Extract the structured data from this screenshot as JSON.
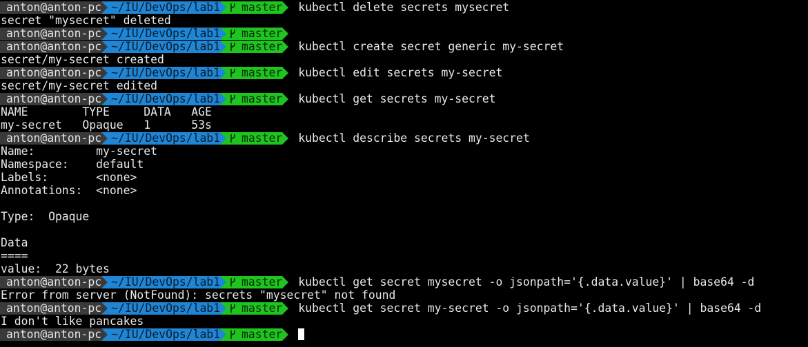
{
  "prompt": {
    "user_host": "anton@anton-pc",
    "directory": "~/IU/DevOps/lab1",
    "branch": "master",
    "colors": {
      "user_bg": "#3a3a3a",
      "dir_bg": "#1f86d6",
      "git_bg": "#1ec51e"
    },
    "branch_icon": "git-branch-icon"
  },
  "lines": [
    {
      "kind": "prompt",
      "command": "kubectl delete secrets mysecret"
    },
    {
      "kind": "output",
      "text": "secret \"mysecret\" deleted"
    },
    {
      "kind": "prompt",
      "command": ""
    },
    {
      "kind": "prompt",
      "command": "kubectl create secret generic my-secret"
    },
    {
      "kind": "output",
      "text": "secret/my-secret created"
    },
    {
      "kind": "prompt",
      "command": "kubectl edit secrets my-secret"
    },
    {
      "kind": "output",
      "text": "secret/my-secret edited"
    },
    {
      "kind": "prompt",
      "command": "kubectl get secrets my-secret"
    },
    {
      "kind": "output",
      "text": "NAME        TYPE     DATA   AGE"
    },
    {
      "kind": "output",
      "text": "my-secret   Opaque   1      53s"
    },
    {
      "kind": "prompt",
      "command": "kubectl describe secrets my-secret"
    },
    {
      "kind": "output",
      "text": "Name:         my-secret"
    },
    {
      "kind": "output",
      "text": "Namespace:    default"
    },
    {
      "kind": "output",
      "text": "Labels:       <none>"
    },
    {
      "kind": "output",
      "text": "Annotations:  <none>"
    },
    {
      "kind": "output",
      "text": ""
    },
    {
      "kind": "output",
      "text": "Type:  Opaque"
    },
    {
      "kind": "output",
      "text": ""
    },
    {
      "kind": "output",
      "text": "Data"
    },
    {
      "kind": "output",
      "text": "===="
    },
    {
      "kind": "output",
      "text": "value:  22 bytes"
    },
    {
      "kind": "prompt",
      "command": "kubectl get secret mysecret -o jsonpath='{.data.value}' | base64 -d"
    },
    {
      "kind": "output",
      "text": "Error from server (NotFound): secrets \"mysecret\" not found"
    },
    {
      "kind": "prompt",
      "command": "kubectl get secret my-secret -o jsonpath='{.data.value}' | base64 -d"
    },
    {
      "kind": "output",
      "text": "I don't like pancakes"
    },
    {
      "kind": "prompt",
      "command": "",
      "cursor": true
    }
  ]
}
